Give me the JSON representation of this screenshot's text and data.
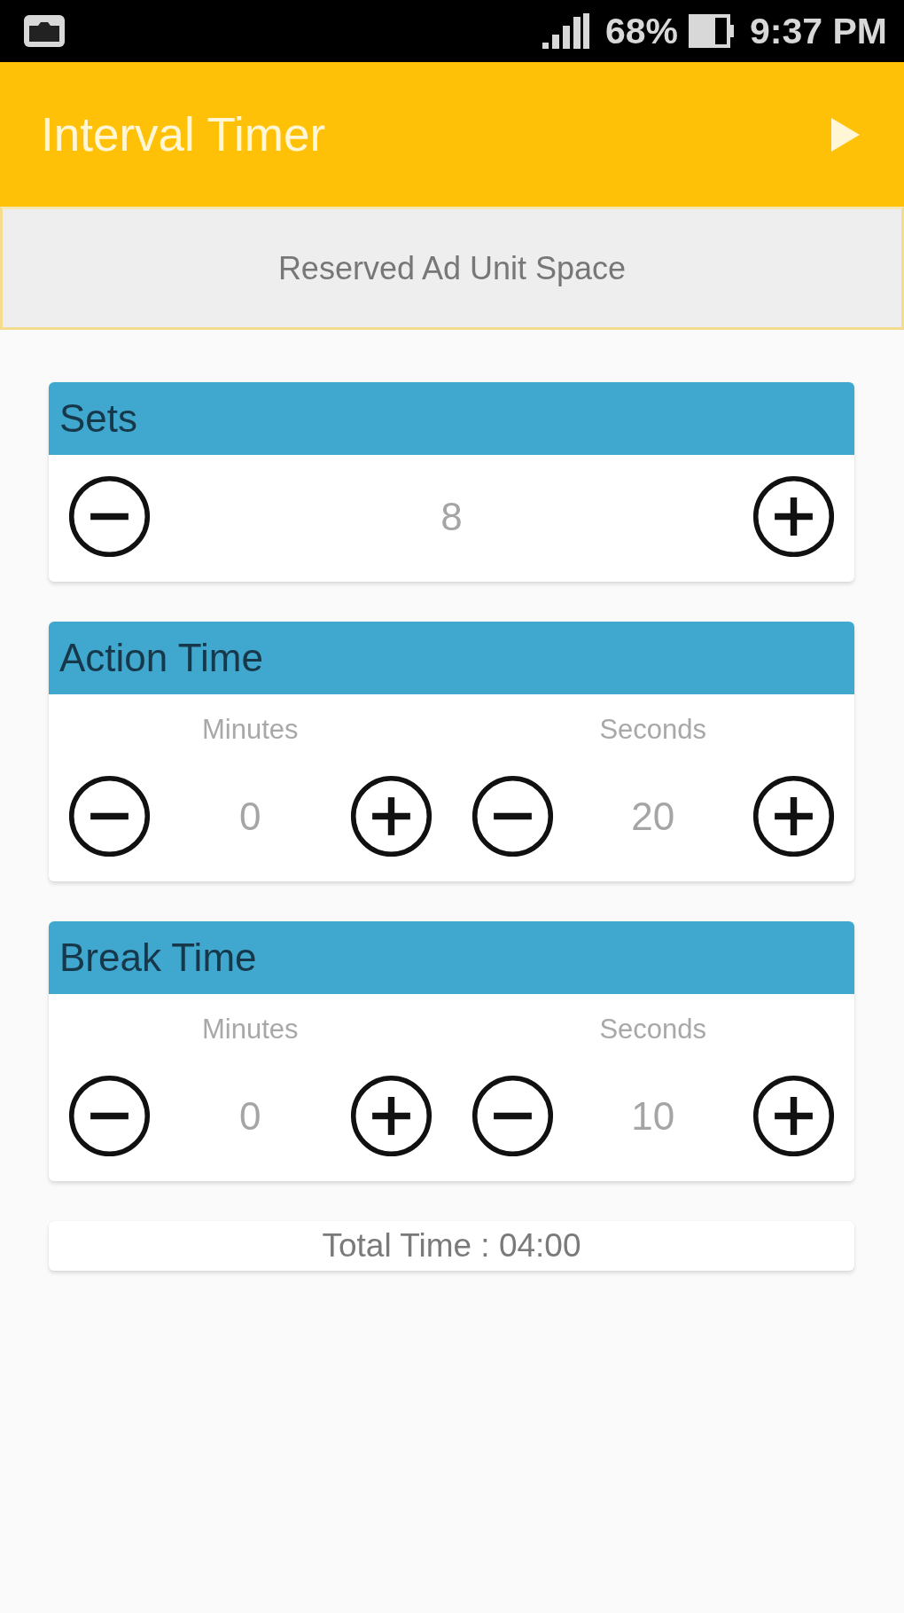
{
  "status_bar": {
    "battery_percent": "68%",
    "time": "9:37 PM"
  },
  "app_bar": {
    "title": "Interval Timer"
  },
  "ad_banner": {
    "text": "Reserved Ad Unit Space"
  },
  "cards": [
    {
      "title": "Sets",
      "steppers": [
        {
          "value": "8"
        }
      ]
    },
    {
      "title": "Action Time",
      "steppers": [
        {
          "label": "Minutes",
          "value": "0"
        },
        {
          "label": "Seconds",
          "value": "20"
        }
      ]
    },
    {
      "title": "Break Time",
      "steppers": [
        {
          "label": "Minutes",
          "value": "0"
        },
        {
          "label": "Seconds",
          "value": "10"
        }
      ]
    }
  ],
  "total": {
    "text": "Total Time : 04:00"
  }
}
